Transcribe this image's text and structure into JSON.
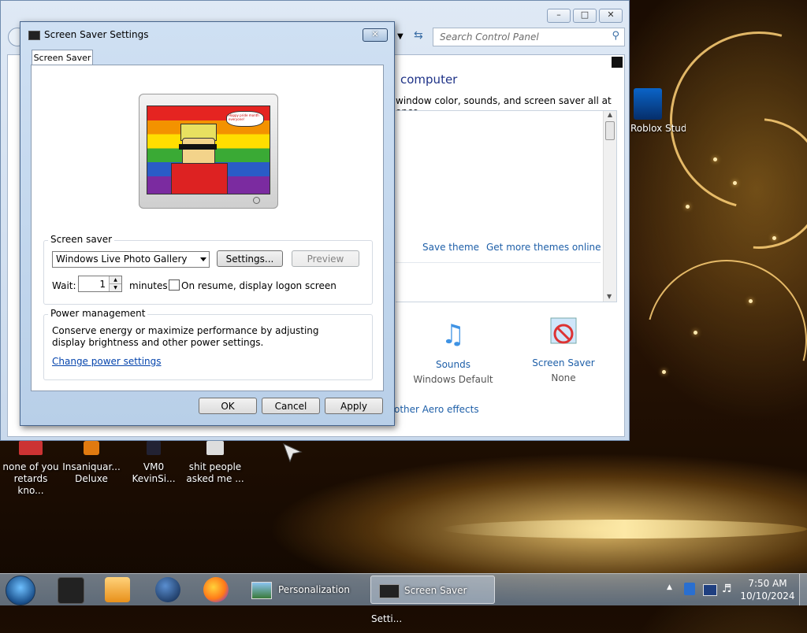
{
  "desktop": {
    "icons": [
      {
        "label": "none of you retards kno..."
      },
      {
        "label": "Insaniquar... Deluxe"
      },
      {
        "label": "VM0 KevinSi..."
      },
      {
        "label": "shit people asked me ..."
      },
      {
        "label": "Roblox Studio"
      }
    ]
  },
  "control_panel": {
    "search_placeholder": "Search Control Panel",
    "heading": "computer",
    "description": "window color, sounds, and screen saver all at once.",
    "save_theme": "Save theme",
    "get_more_themes": "Get more themes online",
    "sounds_label": "Sounds",
    "sounds_value": "Windows Default",
    "screensaver_label": "Screen Saver",
    "screensaver_value": "None",
    "aero_link": "other Aero effects"
  },
  "dialog": {
    "title": "Screen Saver Settings",
    "tab": "Screen Saver",
    "preview_caption": "Happy pride month everyone!",
    "screensaver_group": "Screen saver",
    "screensaver_selected": "Windows Live Photo Gallery",
    "settings_button": "Settings...",
    "preview_button": "Preview",
    "wait_label": "Wait:",
    "wait_value": "1",
    "minutes_label": "minutes",
    "resume_checkbox": "On resume, display logon screen",
    "power_group": "Power management",
    "power_text": "Conserve energy or maximize performance by adjusting display brightness and other power settings.",
    "power_link": "Change power settings",
    "ok": "OK",
    "cancel": "Cancel",
    "apply": "Apply"
  },
  "taskbar": {
    "task_personalization": "Personalization",
    "task_screensaver": "Screen Saver Setti...",
    "time": "7:50 AM",
    "date": "10/10/2024"
  }
}
